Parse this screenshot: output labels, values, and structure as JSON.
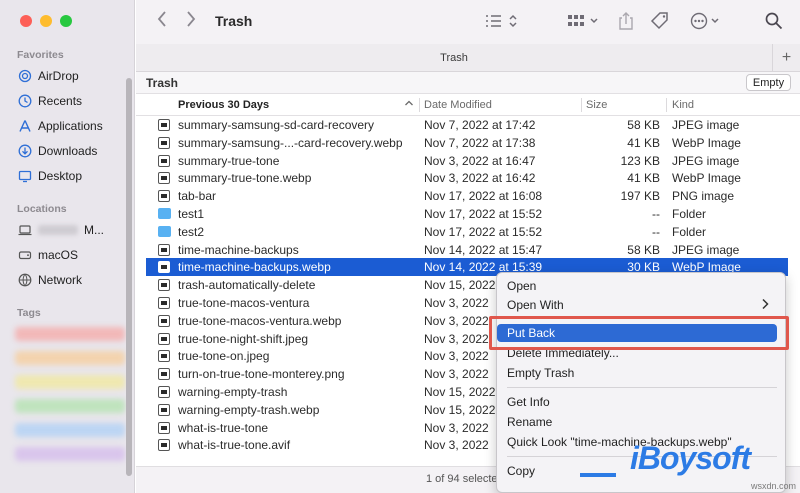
{
  "window": {
    "title": "Trash"
  },
  "sidebar": {
    "favorites_header": "Favorites",
    "favorites": [
      {
        "label": "AirDrop",
        "icon": "airdrop-icon"
      },
      {
        "label": "Recents",
        "icon": "clock-icon"
      },
      {
        "label": "Applications",
        "icon": "applications-icon"
      },
      {
        "label": "Downloads",
        "icon": "download-icon"
      },
      {
        "label": "Desktop",
        "icon": "desktop-icon"
      }
    ],
    "locations_header": "Locations",
    "locations": [
      {
        "label": "M...",
        "icon": "laptop-icon"
      },
      {
        "label": "macOS",
        "icon": "disk-icon"
      },
      {
        "label": "Network",
        "icon": "network-icon"
      }
    ],
    "tags_header": "Tags"
  },
  "tab": {
    "label": "Trash"
  },
  "path": {
    "label": "Trash",
    "empty_button": "Empty"
  },
  "columns": {
    "name": "Previous 30 Days",
    "date": "Date Modified",
    "size": "Size",
    "kind": "Kind"
  },
  "rows": [
    {
      "name": "summary-samsung-sd-card-recovery",
      "date": "Nov 7, 2022 at 17:42",
      "size": "58 KB",
      "kind": "JPEG image",
      "icon": "file"
    },
    {
      "name": "summary-samsung-...-card-recovery.webp",
      "date": "Nov 7, 2022 at 17:38",
      "size": "41 KB",
      "kind": "WebP Image",
      "icon": "file"
    },
    {
      "name": "summary-true-tone",
      "date": "Nov 3, 2022 at 16:47",
      "size": "123 KB",
      "kind": "JPEG image",
      "icon": "file"
    },
    {
      "name": "summary-true-tone.webp",
      "date": "Nov 3, 2022 at 16:42",
      "size": "41 KB",
      "kind": "WebP Image",
      "icon": "file"
    },
    {
      "name": "tab-bar",
      "date": "Nov 17, 2022 at 16:08",
      "size": "197 KB",
      "kind": "PNG image",
      "icon": "file"
    },
    {
      "name": "test1",
      "date": "Nov 17, 2022 at 15:52",
      "size": "--",
      "kind": "Folder",
      "icon": "folder"
    },
    {
      "name": "test2",
      "date": "Nov 17, 2022 at 15:52",
      "size": "--",
      "kind": "Folder",
      "icon": "folder"
    },
    {
      "name": "time-machine-backups",
      "date": "Nov 14, 2022 at 15:47",
      "size": "58 KB",
      "kind": "JPEG image",
      "icon": "file"
    },
    {
      "name": "time-machine-backups.webp",
      "date": "Nov 14, 2022 at 15:39",
      "size": "30 KB",
      "kind": "WebP Image",
      "icon": "file",
      "selected": true
    },
    {
      "name": "trash-automatically-delete",
      "date": "Nov 15, 2022",
      "size": "",
      "kind": "",
      "icon": "file"
    },
    {
      "name": "true-tone-macos-ventura",
      "date": "Nov 3, 2022",
      "size": "",
      "kind": "",
      "icon": "file"
    },
    {
      "name": "true-tone-macos-ventura.webp",
      "date": "Nov 3, 2022",
      "size": "",
      "kind": "",
      "icon": "file"
    },
    {
      "name": "true-tone-night-shift.jpeg",
      "date": "Nov 3, 2022",
      "size": "",
      "kind": "",
      "icon": "file"
    },
    {
      "name": "true-tone-on.jpeg",
      "date": "Nov 3, 2022",
      "size": "",
      "kind": "",
      "icon": "file"
    },
    {
      "name": "turn-on-true-tone-monterey.png",
      "date": "Nov 3, 2022",
      "size": "",
      "kind": "",
      "icon": "file"
    },
    {
      "name": "warning-empty-trash",
      "date": "Nov 15, 2022",
      "size": "",
      "kind": "",
      "icon": "file"
    },
    {
      "name": "warning-empty-trash.webp",
      "date": "Nov 15, 2022",
      "size": "",
      "kind": "",
      "icon": "file"
    },
    {
      "name": "what-is-true-tone",
      "date": "Nov 3, 2022",
      "size": "",
      "kind": "",
      "icon": "file"
    },
    {
      "name": "what-is-true-tone.avif",
      "date": "Nov 3, 2022",
      "size": "",
      "kind": "",
      "icon": "file"
    }
  ],
  "status": {
    "text": "1 of 94 selected"
  },
  "context_menu": {
    "open": "Open",
    "open_with": "Open With",
    "put_back": "Put Back",
    "delete_immediately": "Delete Immediately...",
    "empty_trash": "Empty Trash",
    "get_info": "Get Info",
    "rename": "Rename",
    "quick_look": "Quick Look \"time-machine-backups.webp\"",
    "copy": "Copy"
  },
  "watermark": {
    "brand": "iBoysoft",
    "site": "wsxdn.com"
  },
  "colors": {
    "selection": "#1b5cd3",
    "menu_highlight": "#2d6ad4",
    "callout": "#e0574c",
    "folder": "#58b1f2"
  }
}
